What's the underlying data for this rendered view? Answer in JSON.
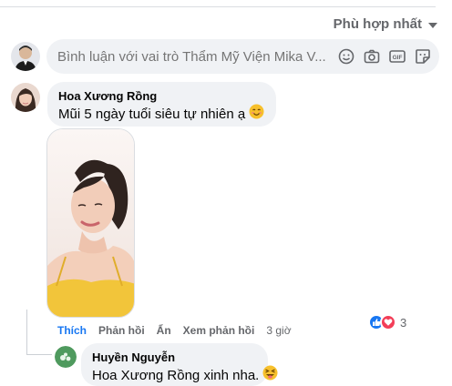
{
  "sort": {
    "label": "Phù hợp nhất"
  },
  "composer": {
    "placeholder": "Bình luận với vai trò Thẩm Mỹ Viện Mika V...",
    "icons": [
      "smiley-icon",
      "camera-icon",
      "gif-icon",
      "sticker-icon"
    ]
  },
  "comments": [
    {
      "author": "Hoa Xương Rồng",
      "text": "Mũi 5 ngày tuổi siêu tự nhiên ạ",
      "emoji": "😊",
      "actions": {
        "like": "Thích",
        "reply": "Phản hồi",
        "hide": "Ẩn",
        "view_replies": "Xem phản hồi",
        "time": "3 giờ"
      },
      "reactions": {
        "types": [
          "like",
          "love"
        ],
        "count": "3"
      }
    },
    {
      "author": "Huyền Nguyễn",
      "text": "Hoa Xương Rồng xinh nha.",
      "emoji": "😝"
    }
  ],
  "colors": {
    "accent": "#1877f2",
    "bubble": "#f0f2f5",
    "muted": "#65676b",
    "love": "#f33e58"
  }
}
